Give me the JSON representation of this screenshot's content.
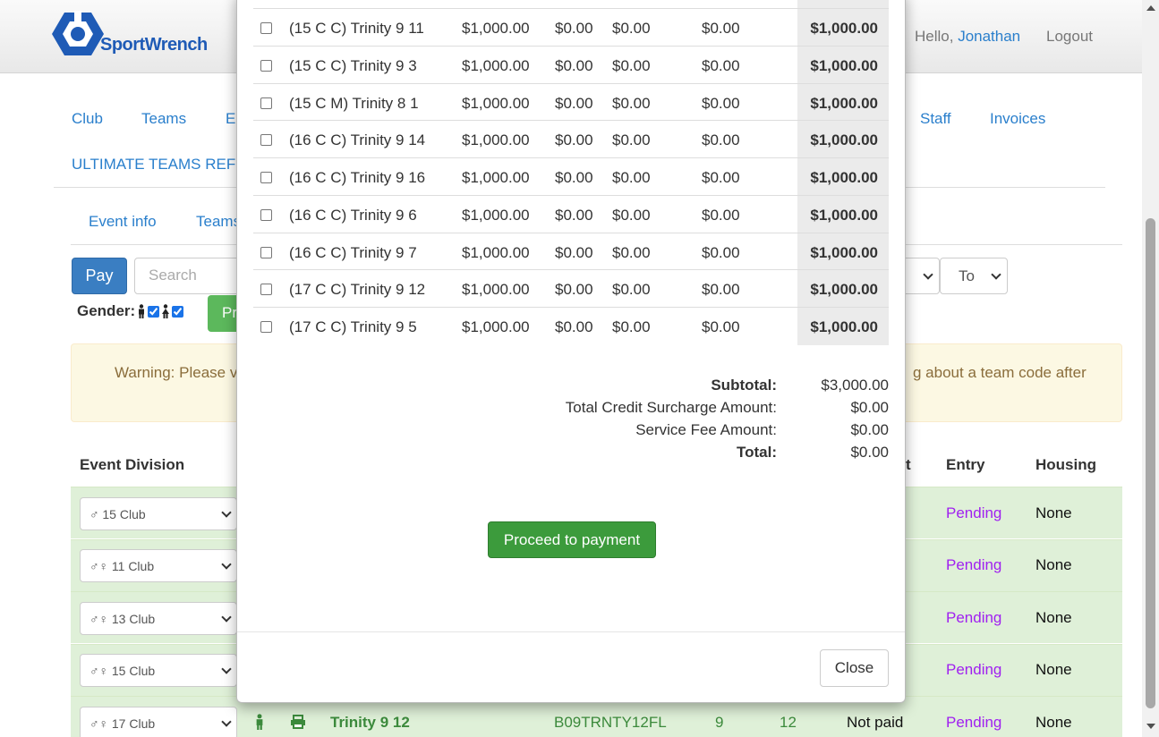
{
  "header": {
    "logo_text": "SportWrench",
    "hello_prefix": "Hello, ",
    "user_name": "Jonathan",
    "logout": "Logout"
  },
  "nav": {
    "club": "Club",
    "teams": "Teams",
    "e_partial": "E",
    "staff": "Staff",
    "invoices": "Invoices",
    "ultimate_partial": "ULTIMATE TEAMS REF"
  },
  "subnav": {
    "event_info": "Event info",
    "teams_partial": "Teams"
  },
  "toolbar": {
    "pay_label": "Pay",
    "search_placeholder": "Search",
    "to_select": "To",
    "gender_label": "Gender:",
    "green_partial": "Pr"
  },
  "warning": {
    "text_left": "Warning: Please v",
    "text_right": "g about a team code after"
  },
  "table_headers": {
    "event_division": "Event Division",
    "t_partial": "t",
    "entry": "Entry",
    "housing": "Housing"
  },
  "bg_rows": [
    {
      "division": "♂ 15 Club",
      "entry": "Pending",
      "housing": "None"
    },
    {
      "division": "♂♀ 11 Club",
      "entry": "Pending",
      "housing": "None"
    },
    {
      "division": "♂♀ 13 Club",
      "entry": "Pending",
      "housing": "None"
    },
    {
      "division": "♂♀ 15 Club",
      "entry": "Pending",
      "housing": "None"
    },
    {
      "division": "♂♀ 17 Club",
      "entry": "Pending",
      "housing": "None",
      "team": "Trinity 9 12",
      "code": "B09TRNTY12FL",
      "age": "9",
      "num": "12",
      "status": "Not paid"
    }
  ],
  "modal": {
    "rows": [
      {
        "team": "(15 C C) Trinity 9 11",
        "fee": "$1,000.00",
        "a": "$0.00",
        "b": "$0.00",
        "c": "$0.00",
        "total": "$1,000.00"
      },
      {
        "team": "(15 C C) Trinity 9 3",
        "fee": "$1,000.00",
        "a": "$0.00",
        "b": "$0.00",
        "c": "$0.00",
        "total": "$1,000.00"
      },
      {
        "team": "(15 C M) Trinity 8 1",
        "fee": "$1,000.00",
        "a": "$0.00",
        "b": "$0.00",
        "c": "$0.00",
        "total": "$1,000.00"
      },
      {
        "team": "(16 C C) Trinity 9 14",
        "fee": "$1,000.00",
        "a": "$0.00",
        "b": "$0.00",
        "c": "$0.00",
        "total": "$1,000.00"
      },
      {
        "team": "(16 C C) Trinity 9 16",
        "fee": "$1,000.00",
        "a": "$0.00",
        "b": "$0.00",
        "c": "$0.00",
        "total": "$1,000.00"
      },
      {
        "team": "(16 C C) Trinity 9 6",
        "fee": "$1,000.00",
        "a": "$0.00",
        "b": "$0.00",
        "c": "$0.00",
        "total": "$1,000.00"
      },
      {
        "team": "(16 C C) Trinity 9 7",
        "fee": "$1,000.00",
        "a": "$0.00",
        "b": "$0.00",
        "c": "$0.00",
        "total": "$1,000.00"
      },
      {
        "team": "(17 C C) Trinity 9 12",
        "fee": "$1,000.00",
        "a": "$0.00",
        "b": "$0.00",
        "c": "$0.00",
        "total": "$1,000.00"
      },
      {
        "team": "(17 C C) Trinity 9 5",
        "fee": "$1,000.00",
        "a": "$0.00",
        "b": "$0.00",
        "c": "$0.00",
        "total": "$1,000.00"
      }
    ],
    "summary": {
      "subtotal_label": "Subtotal:",
      "subtotal_value": "$3,000.00",
      "surcharge_label": "Total Credit Surcharge Amount:",
      "surcharge_value": "$0.00",
      "service_label": "Service Fee Amount:",
      "service_value": "$0.00",
      "total_label": "Total:",
      "total_value": "$0.00"
    },
    "proceed_label": "Proceed to payment",
    "close_label": "Close"
  },
  "colors": {
    "primary": "#3a7ec2",
    "success": "#3c9b3c",
    "link": "#2a7fcc",
    "pending": "#a020f0",
    "row_green": "#dff0d8",
    "warning_bg": "#fcf8e3"
  }
}
